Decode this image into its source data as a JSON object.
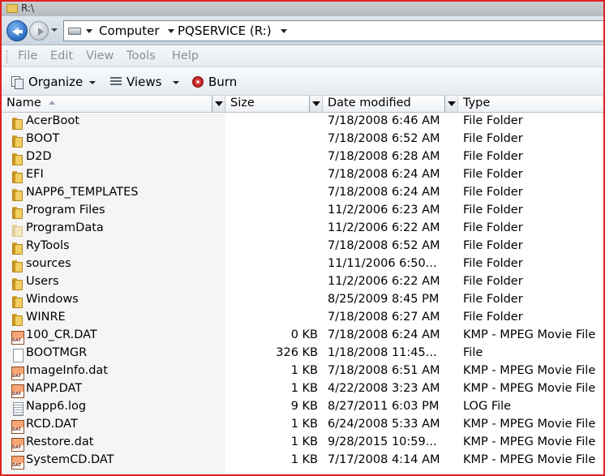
{
  "window": {
    "title": "R:\\"
  },
  "address": {
    "crumbs": [
      "Computer",
      "PQSERVICE (R:)"
    ]
  },
  "menu": [
    "File",
    "Edit",
    "View",
    "Tools",
    "Help"
  ],
  "toolbar": {
    "organize_label": "Organize",
    "views_label": "Views",
    "burn_label": "Burn"
  },
  "columns": {
    "name": "Name",
    "size": "Size",
    "date": "Date modified",
    "type": "Type"
  },
  "files": [
    {
      "name": "AcerBoot",
      "size": "",
      "date": "7/18/2008 6:46 AM",
      "type": "File Folder",
      "icon": "folder-icon"
    },
    {
      "name": "BOOT",
      "size": "",
      "date": "7/18/2008 6:52 AM",
      "type": "File Folder",
      "icon": "folder-icon"
    },
    {
      "name": "D2D",
      "size": "",
      "date": "7/18/2008 6:28 AM",
      "type": "File Folder",
      "icon": "folder-icon"
    },
    {
      "name": "EFI",
      "size": "",
      "date": "7/18/2008 6:24 AM",
      "type": "File Folder",
      "icon": "folder-icon"
    },
    {
      "name": "NAPP6_TEMPLATES",
      "size": "",
      "date": "7/18/2008 6:24 AM",
      "type": "File Folder",
      "icon": "folder-icon"
    },
    {
      "name": "Program Files",
      "size": "",
      "date": "11/2/2006 6:23 AM",
      "type": "File Folder",
      "icon": "folder-icon"
    },
    {
      "name": "ProgramData",
      "size": "",
      "date": "11/2/2006 6:22 AM",
      "type": "File Folder",
      "icon": "hidden-folder-icon"
    },
    {
      "name": "RyTools",
      "size": "",
      "date": "7/18/2008 6:52 AM",
      "type": "File Folder",
      "icon": "folder-icon"
    },
    {
      "name": "sources",
      "size": "",
      "date": "11/11/2006 6:50...",
      "type": "File Folder",
      "icon": "folder-icon"
    },
    {
      "name": "Users",
      "size": "",
      "date": "11/2/2006 6:22 AM",
      "type": "File Folder",
      "icon": "folder-icon"
    },
    {
      "name": "Windows",
      "size": "",
      "date": "8/25/2009 8:45 PM",
      "type": "File Folder",
      "icon": "folder-icon"
    },
    {
      "name": "WINRE",
      "size": "",
      "date": "7/18/2008 6:27 AM",
      "type": "File Folder",
      "icon": "folder-icon"
    },
    {
      "name": "100_CR.DAT",
      "size": "0 KB",
      "date": "7/18/2008 6:24 AM",
      "type": "KMP - MPEG Movie File",
      "icon": "dat-file-icon"
    },
    {
      "name": "BOOTMGR",
      "size": "326 KB",
      "date": "1/18/2008 11:45...",
      "type": "File",
      "icon": "blank-file-icon"
    },
    {
      "name": "ImageInfo.dat",
      "size": "1 KB",
      "date": "7/18/2008 6:51 AM",
      "type": "KMP - MPEG Movie File",
      "icon": "dat-file-icon"
    },
    {
      "name": "NAPP.DAT",
      "size": "1 KB",
      "date": "4/22/2008 3:23 AM",
      "type": "KMP - MPEG Movie File",
      "icon": "dat-file-icon"
    },
    {
      "name": "Napp6.log",
      "size": "9 KB",
      "date": "8/27/2011 6:03 PM",
      "type": "LOG File",
      "icon": "log-file-icon"
    },
    {
      "name": "RCD.DAT",
      "size": "1 KB",
      "date": "6/24/2008 5:33 AM",
      "type": "KMP - MPEG Movie File",
      "icon": "dat-file-icon"
    },
    {
      "name": "Restore.dat",
      "size": "1 KB",
      "date": "9/28/2015 10:59...",
      "type": "KMP - MPEG Movie File",
      "icon": "dat-file-icon"
    },
    {
      "name": "SystemCD.DAT",
      "size": "1 KB",
      "date": "7/17/2008 4:14 AM",
      "type": "KMP - MPEG Movie File",
      "icon": "dat-file-icon"
    }
  ],
  "colors": {
    "frame_border": "#e02020",
    "folder": "#f2cf62",
    "dat_icon": "#f7a574"
  }
}
